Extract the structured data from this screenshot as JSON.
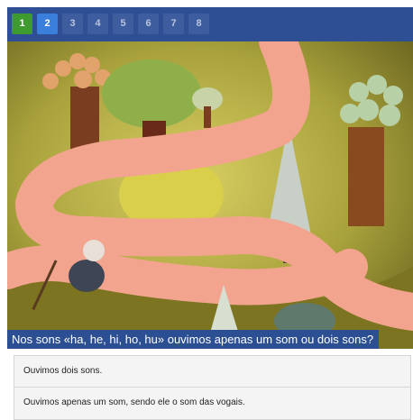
{
  "pager": {
    "pages": [
      {
        "label": "1",
        "state": "done"
      },
      {
        "label": "2",
        "state": "active"
      },
      {
        "label": "3",
        "state": "pending"
      },
      {
        "label": "4",
        "state": "pending"
      },
      {
        "label": "5",
        "state": "pending"
      },
      {
        "label": "6",
        "state": "pending"
      },
      {
        "label": "7",
        "state": "pending"
      },
      {
        "label": "8",
        "state": "pending"
      }
    ]
  },
  "question": {
    "text": "Nos sons «ha, he, hi, ho, hu» ouvimos apenas um som ou dois sons?"
  },
  "answers": [
    {
      "label": "Ouvimos dois sons."
    },
    {
      "label": "Ouvimos apenas um som, sendo ele o som das vogais."
    }
  ],
  "colors": {
    "pager_bg": "#2e4f93",
    "done": "#3f9b2f",
    "active": "#3a7fdc",
    "question_bg": "#2c4f94"
  }
}
